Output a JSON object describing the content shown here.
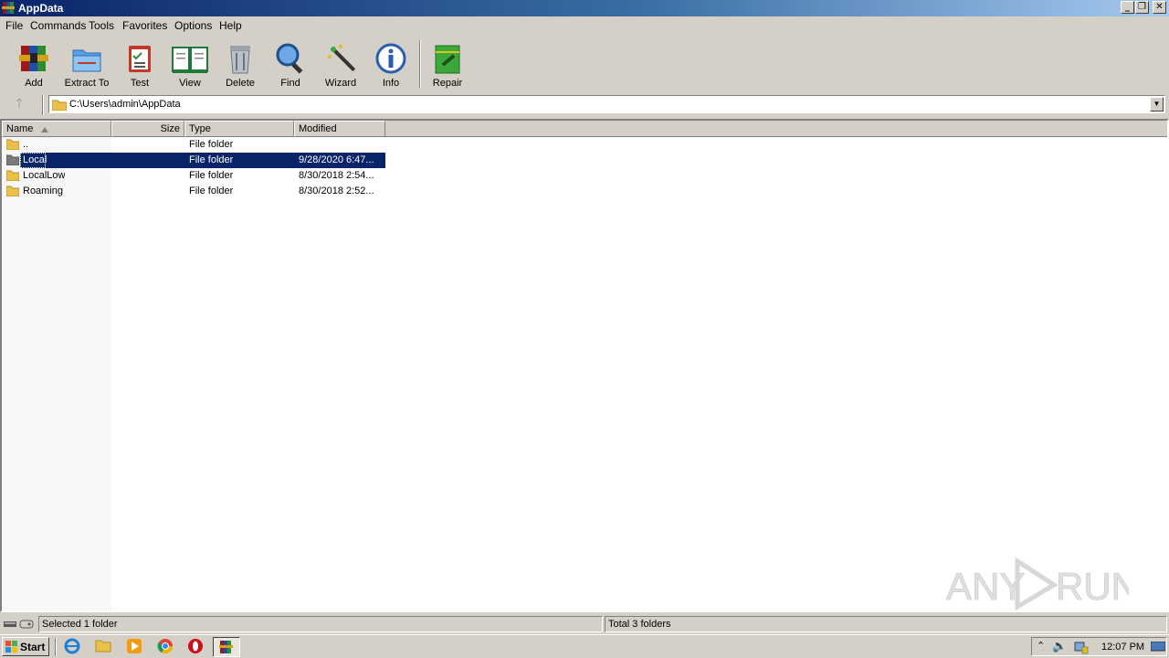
{
  "window": {
    "title": "AppData"
  },
  "menu": [
    "File",
    "Commands",
    "Tools",
    "Favorites",
    "Options",
    "Help"
  ],
  "toolbar": {
    "add": "Add",
    "extract": "Extract To",
    "test": "Test",
    "view": "View",
    "delete": "Delete",
    "find": "Find",
    "wizard": "Wizard",
    "info": "Info",
    "repair": "Repair"
  },
  "address": {
    "path": "C:\\Users\\admin\\AppData"
  },
  "columns": {
    "name": "Name",
    "size": "Size",
    "type": "Type",
    "modified": "Modified"
  },
  "files": [
    {
      "name": "..",
      "size": "",
      "type": "File folder",
      "modified": ""
    },
    {
      "name": "Local",
      "size": "",
      "type": "File folder",
      "modified": "9/28/2020 6:47..."
    },
    {
      "name": "LocalLow",
      "size": "",
      "type": "File folder",
      "modified": "8/30/2018 2:54..."
    },
    {
      "name": "Roaming",
      "size": "",
      "type": "File folder",
      "modified": "8/30/2018 2:52..."
    }
  ],
  "status": {
    "left": "Selected 1 folder",
    "right": "Total 3 folders"
  },
  "taskbar": {
    "start": "Start",
    "clock": "12:07 PM"
  },
  "watermark": "ANY RUN",
  "colors": {
    "selection": "#0a246a",
    "titlebar_start": "#0a246a",
    "titlebar_end": "#a6caf0"
  }
}
